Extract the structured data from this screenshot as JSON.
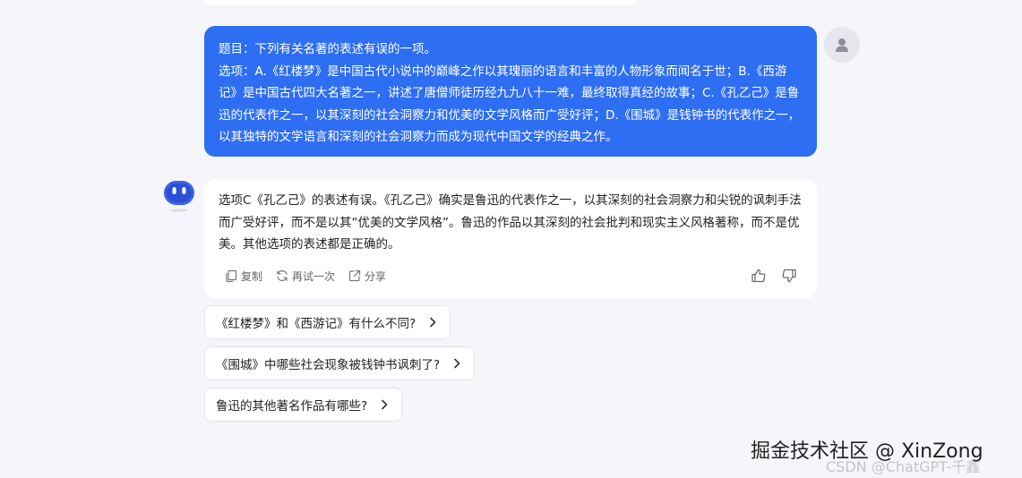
{
  "user_message": {
    "question": "题目：下列有关名著的表述有误的一项。",
    "options": "选项：A.《红楼梦》是中国古代小说中的巅峰之作以其瑰丽的语言和丰富的人物形象而闻名于世；B.《西游记》是中国古代四大名著之一，讲述了唐僧师徒历经九九八十一难，最终取得真经的故事；C.《孔乙己》是鲁迅的代表作之一，以其深刻的社会洞察力和优美的文学风格而广受好评；D.《围城》是钱钟书的代表作之一，以其独特的文学语言和深刻的社会洞察力而成为现代中国文学的经典之作。"
  },
  "bot_message": {
    "text": "选项C《孔乙己》的表述有误。《孔乙己》确实是鲁迅的代表作之一，以其深刻的社会洞察力和尖锐的讽刺手法而广受好评，而不是以其“优美的文学风格”。鲁迅的作品以其深刻的社会批判和现实主义风格著称，而不是优美。其他选项的表述都是正确的。"
  },
  "actions": {
    "copy": "复制",
    "retry": "再试一次",
    "share": "分享"
  },
  "suggestions": [
    "《红楼梦》和《西游记》有什么不同?",
    "《围城》中哪些社会现象被钱钟书讽刺了?",
    "鲁迅的其他著名作品有哪些?"
  ],
  "watermark": {
    "main": "掘金技术社区 @ XinZong",
    "sub": "CSDN @ChatGPT-千鑫"
  },
  "colors": {
    "accent": "#2e6ef3",
    "background": "#f5f6fa"
  }
}
